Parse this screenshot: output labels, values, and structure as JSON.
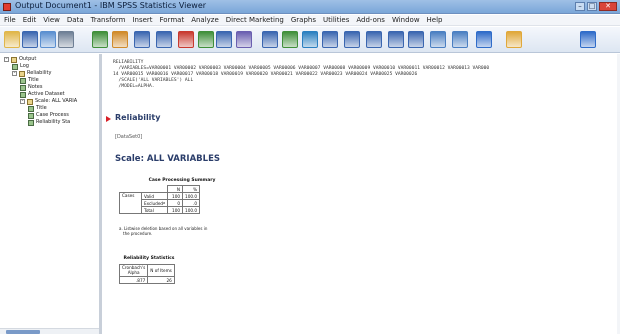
{
  "window": {
    "title": "Output Document1 - IBM SPSS Statistics Viewer"
  },
  "menu": [
    "File",
    "Edit",
    "View",
    "Data",
    "Transform",
    "Insert",
    "Format",
    "Analyze",
    "Direct Marketing",
    "Graphs",
    "Utilities",
    "Add-ons",
    "Window",
    "Help"
  ],
  "toolbar": {
    "icons": [
      "open-icon",
      "save-icon",
      "print-icon",
      "print-preview-icon",
      "export-icon",
      "recall-dialog-icon",
      "undo-icon",
      "redo-icon",
      "goto-data-icon",
      "goto-case-icon",
      "goto-variable-icon",
      "variables-icon",
      "use-sets-icon",
      "show-all-icon",
      "select-output-icon",
      "designate-window-icon",
      "promote-icon",
      "demote-icon",
      "expand-icon",
      "collapse-icon",
      "show-icon",
      "hide-icon",
      "insert-heading-icon",
      "insert-title-icon",
      "insert-text-icon"
    ],
    "colors": {
      "accent": "#3a66b0",
      "red": "#d81f26",
      "green": "#3f8f3a"
    }
  },
  "nav": {
    "items": [
      {
        "label": "Output",
        "level": 0,
        "icon": "output-book-icon",
        "expander": "-"
      },
      {
        "label": "Log",
        "level": 1,
        "icon": "log-icon"
      },
      {
        "label": "Reliability",
        "level": 1,
        "icon": "book-icon",
        "expander": "-"
      },
      {
        "label": "Title",
        "level": 2,
        "icon": "title-icon"
      },
      {
        "label": "Notes",
        "level": 2,
        "icon": "notes-icon"
      },
      {
        "label": "Active Dataset",
        "level": 2,
        "icon": "dataset-icon"
      },
      {
        "label": "Scale: ALL VARIA",
        "level": 2,
        "icon": "book-icon",
        "expander": "-"
      },
      {
        "label": "Title",
        "level": 3,
        "icon": "title-icon"
      },
      {
        "label": "Case Process",
        "level": 3,
        "icon": "table-icon"
      },
      {
        "label": "Reliability Sta",
        "level": 3,
        "icon": "table-icon"
      }
    ]
  },
  "content": {
    "syntax_lines": [
      "RELIABILITY",
      "  /VARIABLES=VAR00001 VAR00002 VAR00003 VAR00004 VAR00005 VAR00006 VAR00007 VAR00008 VAR00009 VAR00010 VAR00011 VAR00012 VAR00013 VAR000",
      "14 VAR00015 VAR00016 VAR00017 VAR00018 VAR00019 VAR00020 VAR00021 VAR00022 VAR00023 VAR00024 VAR00025 VAR00026",
      "  /SCALE('ALL VARIABLES') ALL",
      "  /MODEL=ALPHA."
    ],
    "heading": "Reliability",
    "dataset": "[DataSet0]",
    "scale_title": "Scale: ALL VARIABLES",
    "case_summary": {
      "caption": "Case Processing Summary",
      "col_headers": [
        "N",
        "%"
      ],
      "group_label": "Cases",
      "rows": [
        {
          "label": "Valid",
          "n": "100",
          "pct": "100.0"
        },
        {
          "label": "Excludedª",
          "n": "0",
          "pct": ".0"
        },
        {
          "label": "Total",
          "n": "100",
          "pct": "100.0"
        }
      ],
      "footnote_line1": "a. Listwise deletion based on all variables in",
      "footnote_line2": "the procedure."
    },
    "reliability_stats": {
      "caption": "Reliability Statistics",
      "col_headers": [
        "Cronbach's Alpha",
        "N of Items"
      ],
      "alpha": ".877",
      "n_items": "26"
    }
  }
}
